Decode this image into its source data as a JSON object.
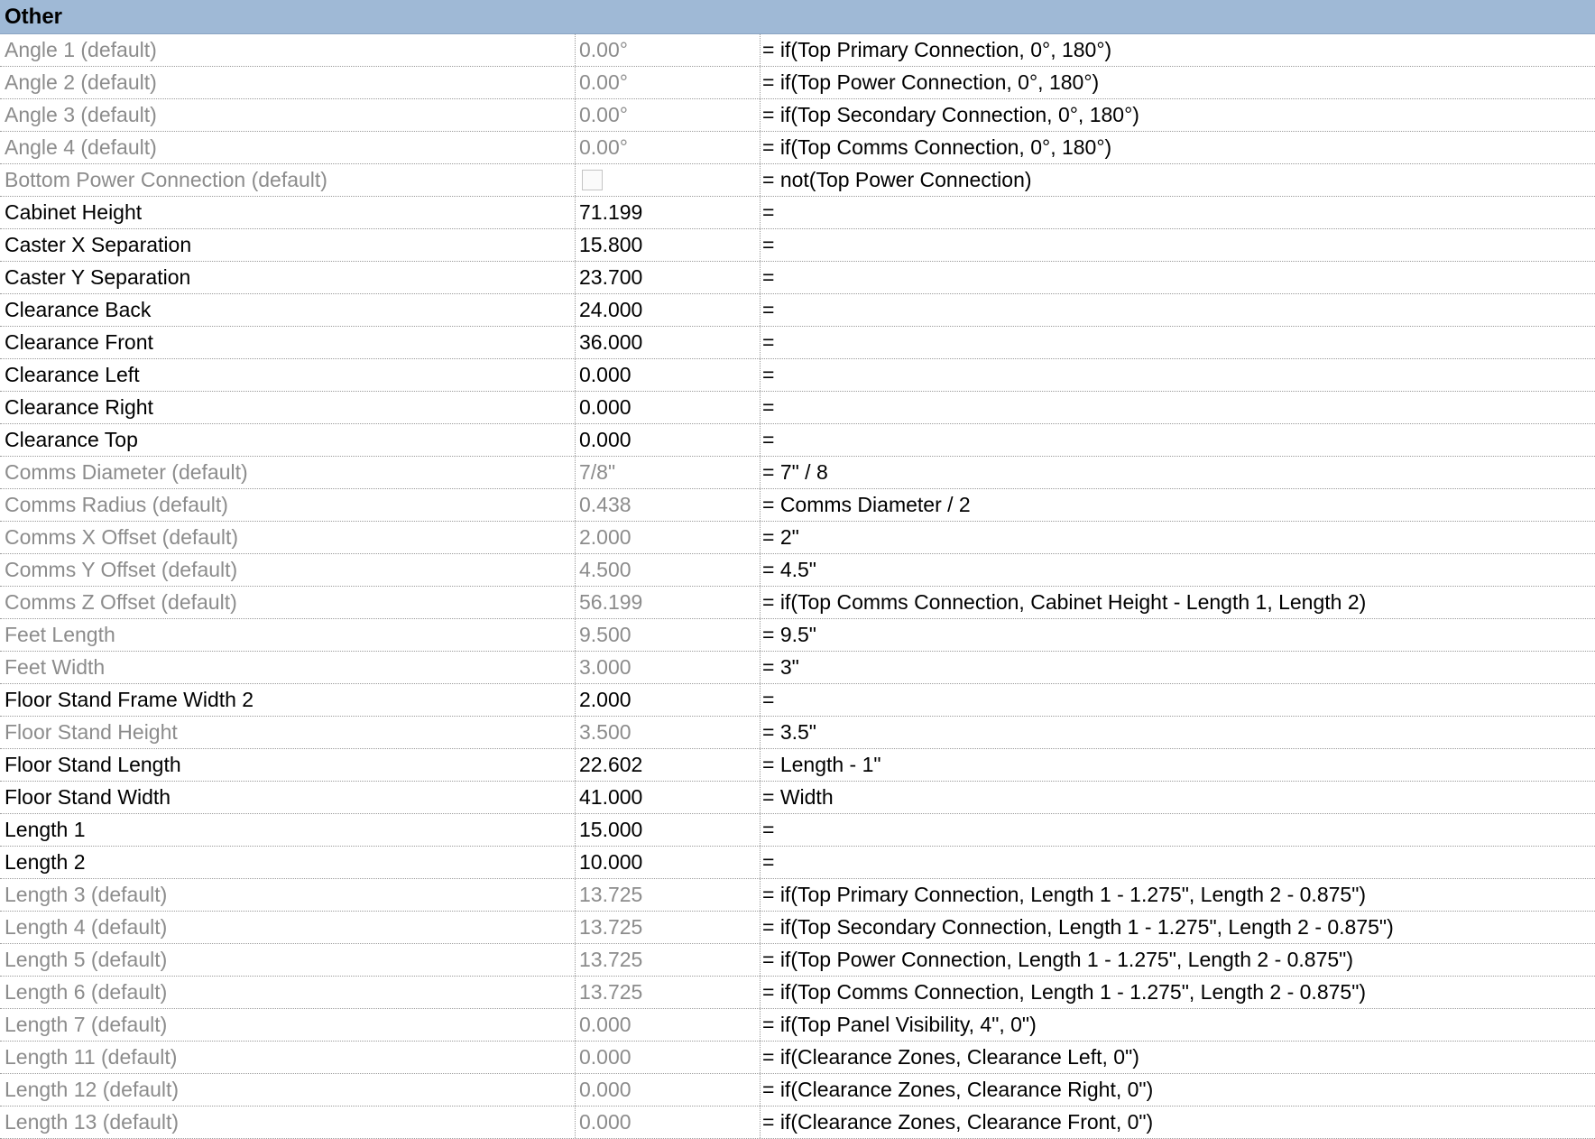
{
  "group": {
    "title": "Other"
  },
  "rows": [
    {
      "name": "Angle 1 (default)",
      "value": "0.00°",
      "formula": "= if(Top Primary Connection, 0°, 180°)",
      "is_default": true
    },
    {
      "name": "Angle 2 (default)",
      "value": "0.00°",
      "formula": "= if(Top Power Connection, 0°, 180°)",
      "is_default": true
    },
    {
      "name": "Angle 3 (default)",
      "value": "0.00°",
      "formula": "= if(Top Secondary Connection, 0°, 180°)",
      "is_default": true
    },
    {
      "name": "Angle 4 (default)",
      "value": "0.00°",
      "formula": "= if(Top Comms Connection, 0°, 180°)",
      "is_default": true
    },
    {
      "name": "Bottom Power Connection (default)",
      "value": "",
      "checkbox": true,
      "checked": false,
      "formula": "= not(Top Power Connection)",
      "is_default": true
    },
    {
      "name": "Cabinet Height",
      "value": "71.199",
      "formula": "=",
      "is_default": false
    },
    {
      "name": "Caster X Separation",
      "value": "15.800",
      "formula": "=",
      "is_default": false
    },
    {
      "name": "Caster Y Separation",
      "value": "23.700",
      "formula": "=",
      "is_default": false
    },
    {
      "name": "Clearance Back",
      "value": "24.000",
      "formula": "=",
      "is_default": false
    },
    {
      "name": "Clearance Front",
      "value": "36.000",
      "formula": "=",
      "is_default": false
    },
    {
      "name": "Clearance Left",
      "value": "0.000",
      "formula": "=",
      "is_default": false
    },
    {
      "name": "Clearance Right",
      "value": "0.000",
      "formula": "=",
      "is_default": false
    },
    {
      "name": "Clearance Top",
      "value": "0.000",
      "formula": "=",
      "is_default": false
    },
    {
      "name": "Comms Diameter (default)",
      "value": "7/8\"",
      "formula": "= 7\" / 8",
      "is_default": true
    },
    {
      "name": "Comms Radius (default)",
      "value": "0.438",
      "formula": "= Comms Diameter / 2",
      "is_default": true
    },
    {
      "name": "Comms X Offset (default)",
      "value": "2.000",
      "formula": "= 2\"",
      "is_default": true
    },
    {
      "name": "Comms Y Offset (default)",
      "value": "4.500",
      "formula": "= 4.5\"",
      "is_default": true
    },
    {
      "name": "Comms Z Offset (default)",
      "value": "56.199",
      "formula": "= if(Top Comms Connection, Cabinet Height - Length 1, Length 2)",
      "is_default": true
    },
    {
      "name": "Feet Length",
      "value": "9.500",
      "formula": "= 9.5\"",
      "is_default": true
    },
    {
      "name": "Feet Width",
      "value": "3.000",
      "formula": "= 3\"",
      "is_default": true
    },
    {
      "name": "Floor Stand Frame Width 2",
      "value": "2.000",
      "formula": "=",
      "is_default": false
    },
    {
      "name": "Floor Stand Height",
      "value": "3.500",
      "formula": "= 3.5\"",
      "is_default": true
    },
    {
      "name": "Floor Stand Length",
      "value": "22.602",
      "formula": "= Length - 1\"",
      "is_default": false
    },
    {
      "name": "Floor Stand Width",
      "value": "41.000",
      "formula": "= Width",
      "is_default": false
    },
    {
      "name": "Length 1",
      "value": "15.000",
      "formula": "=",
      "is_default": false
    },
    {
      "name": "Length 2",
      "value": "10.000",
      "formula": "=",
      "is_default": false
    },
    {
      "name": "Length 3 (default)",
      "value": "13.725",
      "formula": "= if(Top Primary Connection, Length 1 - 1.275\", Length 2 - 0.875\")",
      "is_default": true
    },
    {
      "name": "Length 4 (default)",
      "value": "13.725",
      "formula": "= if(Top Secondary Connection, Length 1 - 1.275\", Length 2 - 0.875\")",
      "is_default": true
    },
    {
      "name": "Length 5 (default)",
      "value": "13.725",
      "formula": "= if(Top Power Connection, Length 1 - 1.275\", Length 2 - 0.875\")",
      "is_default": true
    },
    {
      "name": "Length 6 (default)",
      "value": "13.725",
      "formula": "= if(Top Comms Connection, Length 1 - 1.275\", Length 2 - 0.875\")",
      "is_default": true
    },
    {
      "name": "Length 7 (default)",
      "value": "0.000",
      "formula": "= if(Top Panel Visibility, 4\", 0\")",
      "is_default": true
    },
    {
      "name": "Length 11 (default)",
      "value": "0.000",
      "formula": "= if(Clearance Zones, Clearance Left, 0\")",
      "is_default": true
    },
    {
      "name": "Length 12 (default)",
      "value": "0.000",
      "formula": "= if(Clearance Zones, Clearance Right, 0\")",
      "is_default": true
    },
    {
      "name": "Length 13 (default)",
      "value": "0.000",
      "formula": "= if(Clearance Zones, Clearance Front, 0\")",
      "is_default": true
    }
  ],
  "colors": {
    "group_header_bg": "#9fb9d6",
    "default_text": "#8c8c8c",
    "normal_text": "#000000",
    "grid_line": "#9a9a9a"
  }
}
